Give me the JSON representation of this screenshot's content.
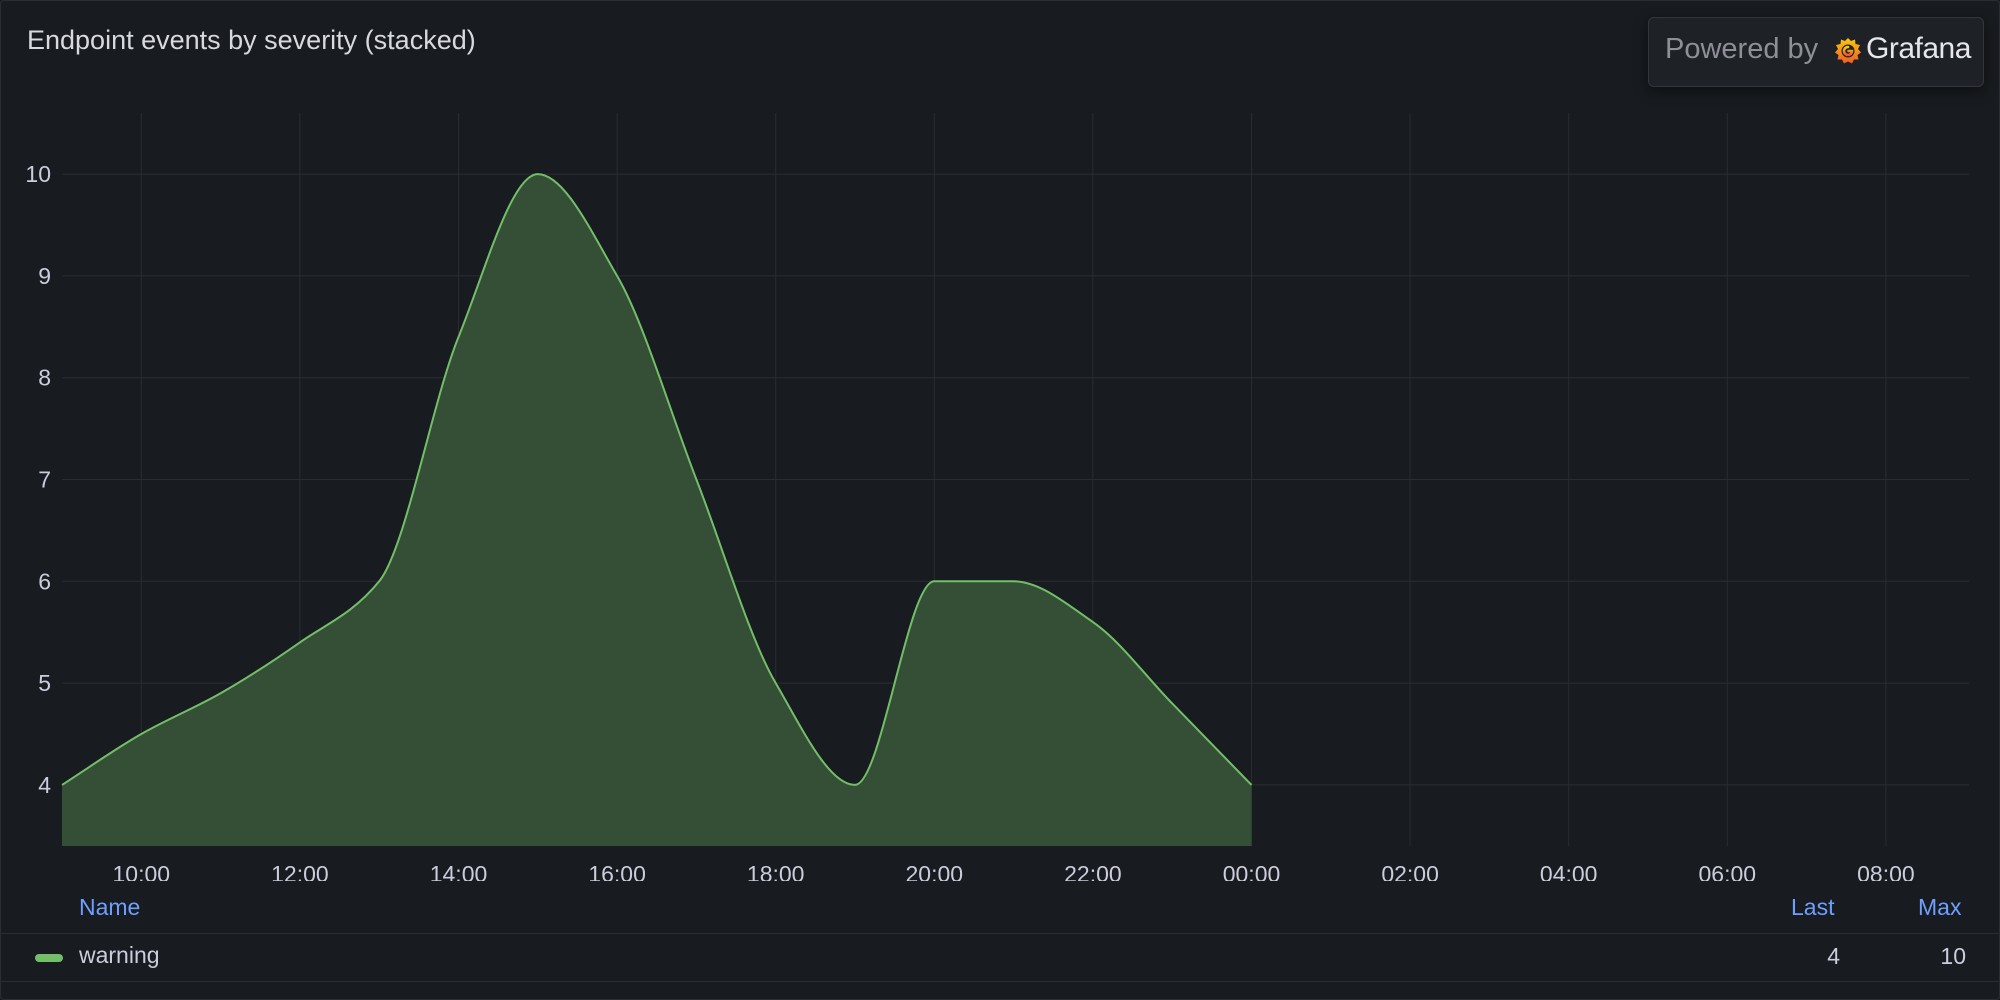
{
  "panel": {
    "title": "Endpoint events by severity (stacked)",
    "powered_by": "Powered by",
    "grafana_label": "Grafana"
  },
  "legend": {
    "headers": {
      "name": "Name",
      "last": "Last",
      "max": "Max"
    },
    "rows": [
      {
        "name": "warning",
        "color": "#73bf69",
        "last": "4",
        "max": "10"
      }
    ]
  },
  "colors": {
    "series_line": "#73bf69",
    "series_fill": "#344f35",
    "grid": "#2a2c31",
    "axis_text": "#ccccdc",
    "legend_header": "#6e9fff",
    "background": "#181b1f"
  },
  "chart_data": {
    "type": "area",
    "title": "Endpoint events by severity (stacked)",
    "stacked": true,
    "x_unit": "time (HH:MM)",
    "x_ticks": [
      "10:00",
      "12:00",
      "14:00",
      "16:00",
      "18:00",
      "20:00",
      "22:00",
      "00:00",
      "02:00",
      "04:00",
      "06:00",
      "08:00"
    ],
    "y_ticks": [
      4,
      5,
      6,
      7,
      8,
      9,
      10
    ],
    "ylim": [
      3.4,
      10.6
    ],
    "xlabel": "",
    "ylabel": "",
    "grid": true,
    "legend": "bottom",
    "series": [
      {
        "name": "warning",
        "x": [
          "09:00",
          "10:00",
          "11:00",
          "12:00",
          "13:00",
          "14:00",
          "15:00",
          "16:00",
          "17:00",
          "18:00",
          "19:00",
          "20:00",
          "21:00",
          "22:00",
          "23:00",
          "00:00"
        ],
        "values": [
          4,
          4.5,
          4.9,
          5.4,
          6,
          8.4,
          10,
          9,
          7,
          5,
          4,
          6,
          6,
          5.6,
          4.8,
          4
        ]
      }
    ]
  }
}
